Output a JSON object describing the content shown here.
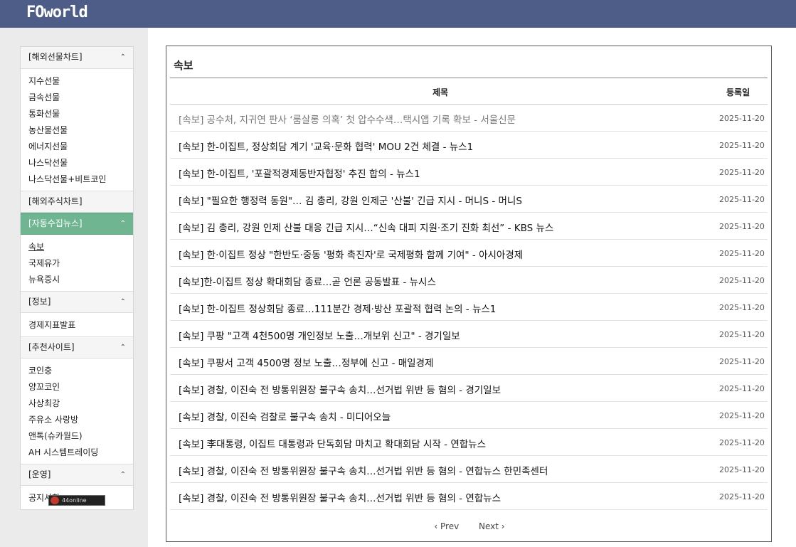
{
  "header": {
    "logo": "FOworld"
  },
  "sidebar": {
    "groups": [
      {
        "label": "[해외선물차트]",
        "expanded": true,
        "items": [
          "지수선물",
          "금속선물",
          "통화선물",
          "농산물선물",
          "에너지선물",
          "나스닥선물",
          "나스닥선물+비트코인"
        ]
      },
      {
        "label": "[해외주식차트]",
        "expanded": false,
        "items": []
      },
      {
        "label": "[자동수집뉴스]",
        "expanded": true,
        "active": true,
        "items": [
          "속보",
          "국제유가",
          "뉴욕증시"
        ]
      },
      {
        "label": "[정보]",
        "expanded": true,
        "items": [
          "경제지표발표"
        ]
      },
      {
        "label": "[추천사이트]",
        "expanded": true,
        "items": [
          "코인충",
          "양꼬코인",
          "사상최강",
          "주유소 사랑방",
          "앤톡(슈카월드)",
          "AH 시스템트레이딩"
        ]
      },
      {
        "label": "[운영]",
        "expanded": true,
        "items": [
          "공지사항"
        ]
      }
    ],
    "badge": "44online"
  },
  "news": {
    "title": "속보",
    "col_title": "제목",
    "col_date": "등록일",
    "rows": [
      {
        "title": "[속보] 공수처, 지귀연 판사 ‘룸살롱 의혹’ 첫 압수수색…택시앱 기록 확보 - 서울신문",
        "date": "2025-11-20"
      },
      {
        "title": "[속보] 한-이집트, 정상회담 계기 '교육·문화 협력' MOU 2건 체결 - 뉴스1",
        "date": "2025-11-20"
      },
      {
        "title": "[속보] 한-이집트, '포괄적경제동반자협정' 추진 합의 - 뉴스1",
        "date": "2025-11-20"
      },
      {
        "title": "[속보] \"필요한 행정력 동원\"… 김 총리, 강원 인제군 '산불' 긴급 지시 - 머니S - 머니S",
        "date": "2025-11-20"
      },
      {
        "title": "[속보] 김 총리, 강원 인제 산불 대응 긴급 지시…“신속 대피 지원·조기 진화 최선” - KBS 뉴스",
        "date": "2025-11-20"
      },
      {
        "title": "[속보] 한·이집트 정상 \"한반도·중동 '평화 촉진자'로 국제평화 함께 기여\" - 아시아경제",
        "date": "2025-11-20"
      },
      {
        "title": "[속보]한-이집트 정상 확대회담 종료…곧 언론 공동발표 - 뉴시스",
        "date": "2025-11-20"
      },
      {
        "title": "[속보] 한-이집트 정상회담 종료…111분간 경제·방산 포괄적 협력 논의 - 뉴스1",
        "date": "2025-11-20"
      },
      {
        "title": "[속보] 쿠팡 \"고객 4천500명 개인정보 노출…개보위 신고\" - 경기일보",
        "date": "2025-11-20"
      },
      {
        "title": "[속보] 쿠팡서 고객 4500명 정보 노출…정부에 신고 - 매일경제",
        "date": "2025-11-20"
      },
      {
        "title": "[속보] 경찰, 이진숙 전 방통위원장 불구속 송치…선거법 위반 등 혐의 - 경기일보",
        "date": "2025-11-20"
      },
      {
        "title": "[속보] 경찰, 이진숙 검찰로 불구속 송치 - 미디어오늘",
        "date": "2025-11-20"
      },
      {
        "title": "[속보] 李대통령, 이집트 대통령과 단독회담 마치고 확대회담 시작 - 연합뉴스",
        "date": "2025-11-20"
      },
      {
        "title": "[속보] 경찰, 이진숙 전 방통위원장 불구속 송치…선거법 위반 등 혐의 - 연합뉴스 한민족센터",
        "date": "2025-11-20"
      },
      {
        "title": "[속보] 경찰, 이진숙 전 방통위원장 불구속 송치…선거법 위반 등 혐의 - 연합뉴스",
        "date": "2025-11-20"
      }
    ],
    "prev": "‹ Prev",
    "next": "Next ›"
  },
  "colors": {
    "topbar": "#4e5d87",
    "active_menu": "#6fb592"
  }
}
